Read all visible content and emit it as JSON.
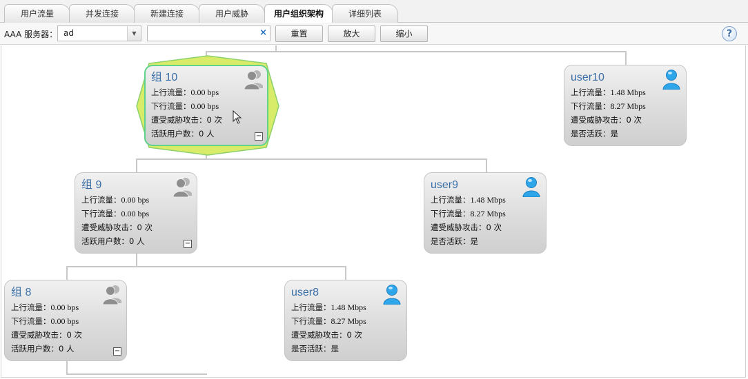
{
  "tabs": [
    {
      "label": "用户流量",
      "active": false
    },
    {
      "label": "并发连接",
      "active": false
    },
    {
      "label": "新建连接",
      "active": false
    },
    {
      "label": "用户威胁",
      "active": false
    },
    {
      "label": "用户组织架构",
      "active": true
    },
    {
      "label": "详细列表",
      "active": false
    }
  ],
  "toolbar": {
    "server_label": "AAA 服务器：",
    "server_value": "ad",
    "search_value": "",
    "clear_icon": "×",
    "reset_label": "重置",
    "zoom_in_label": "放大",
    "zoom_out_label": "缩小",
    "help_label": "?"
  },
  "nodes": {
    "group10": {
      "title": "组 10",
      "up_k": "上行流量：",
      "up_v": "0.00 bps",
      "down_k": "下行流量：",
      "down_v": "0.00 bps",
      "threat_k": "遭受威胁攻击：",
      "threat_v": "0 次",
      "active_k": "活跃用户数：",
      "active_v": "0 人",
      "collapse": "−"
    },
    "user10": {
      "title": "user10",
      "up_k": "上行流量：",
      "up_v": "1.48 Mbps",
      "down_k": "下行流量：",
      "down_v": "8.27 Mbps",
      "threat_k": "遭受威胁攻击：",
      "threat_v": "0 次",
      "active_k": "是否活跃：",
      "active_v": "是"
    },
    "group9": {
      "title": "组 9",
      "up_k": "上行流量：",
      "up_v": "0.00 bps",
      "down_k": "下行流量：",
      "down_v": "0.00 bps",
      "threat_k": "遭受威胁攻击：",
      "threat_v": "0 次",
      "active_k": "活跃用户数：",
      "active_v": "0 人",
      "collapse": "−"
    },
    "user9": {
      "title": "user9",
      "up_k": "上行流量：",
      "up_v": "1.48 Mbps",
      "down_k": "下行流量：",
      "down_v": "8.27 Mbps",
      "threat_k": "遭受威胁攻击：",
      "threat_v": "0 次",
      "active_k": "是否活跃：",
      "active_v": "是"
    },
    "group8": {
      "title": "组 8",
      "up_k": "上行流量：",
      "up_v": "0.00 bps",
      "down_k": "下行流量：",
      "down_v": "0.00 bps",
      "threat_k": "遭受威胁攻击：",
      "threat_v": "0 次",
      "active_k": "活跃用户数：",
      "active_v": "0 人",
      "collapse": "−"
    },
    "user8": {
      "title": "user8",
      "up_k": "上行流量：",
      "up_v": "1.48 Mbps",
      "down_k": "下行流量：",
      "down_v": "8.27 Mbps",
      "threat_k": "遭受威胁攻击：",
      "threat_v": "0 次",
      "active_k": "是否活跃：",
      "active_v": "是"
    }
  },
  "icons": {
    "group": "group-icon",
    "user": "user-icon",
    "selection": "selection-highlight"
  },
  "colors": {
    "title": "#3a6fa8",
    "user_icon": "#29a3e6",
    "group_icon": "#9a9a9a",
    "halo_fill": "#d9ec6a",
    "halo_stroke": "#5fd38a",
    "connector": "#c8c8c8"
  }
}
